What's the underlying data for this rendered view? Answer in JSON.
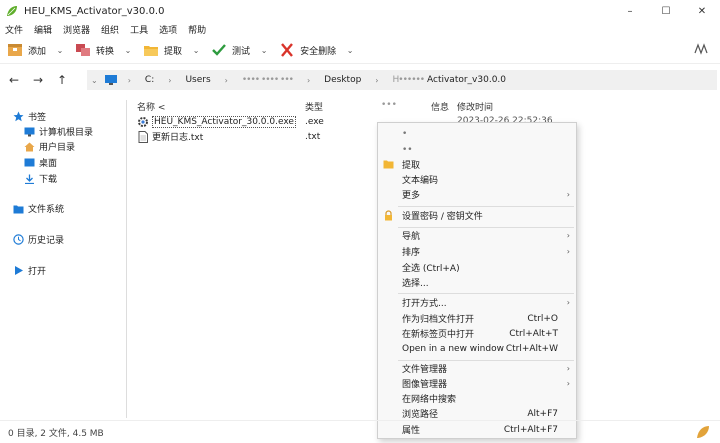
{
  "window": {
    "title": "HEU_KMS_Activator_v30.0.0",
    "minimize": "–",
    "maximize": "☐",
    "close": "✕"
  },
  "menu": [
    "文件",
    "编辑",
    "浏览器",
    "组织",
    "工具",
    "选项",
    "帮助"
  ],
  "toolbar": {
    "add": "添加",
    "convert": "转换",
    "extract": "提取",
    "test": "测试",
    "secure_delete": "安全删除"
  },
  "breadcrumb": {
    "drive": "C:",
    "users": "Users",
    "user": "•••• •••• •••",
    "desktop": "Desktop",
    "folder_prefix": "H••••••",
    "folder": "Activator_v30.0.0"
  },
  "sidebar": {
    "bookmarks": "书签",
    "computer_root": "计算机根目录",
    "user_dir": "用户目录",
    "desktop": "桌面",
    "downloads": "下载",
    "filesystem": "文件系统",
    "history": "历史记录",
    "open": "打开"
  },
  "columns": {
    "name": "名称",
    "sort": "<",
    "type": "类型",
    "size": "•••",
    "info": "信息",
    "modified": "修改时间"
  },
  "files": [
    {
      "name": "HEU_KMS_Activator_30.0.0.exe",
      "type": ".exe",
      "modified": "2023-02-26 22:52:36"
    },
    {
      "name": "更新日志.txt",
      "type": ".txt"
    }
  ],
  "context_menu": {
    "item1": "•",
    "item2": "••",
    "extract": "提取",
    "text_encoding": "文本编码",
    "more": "更多",
    "set_password": "设置密码 / 密钥文件",
    "navigate": "导航",
    "sort": "排序",
    "select_all": "全选 (Ctrl+A)",
    "select": "选择...",
    "open_with": "打开方式...",
    "open_as_archive": "作为归档文件打开",
    "open_as_archive_key": "Ctrl+O",
    "open_new_tab": "在新标签页中打开",
    "open_new_tab_key": "Ctrl+Alt+T",
    "open_new_window": "Open in a new window",
    "open_new_window_key": "Ctrl+Alt+W",
    "file_manager": "文件管理器",
    "image_manager": "图像管理器",
    "search_web": "在网络中搜索",
    "browse_path": "浏览路径",
    "browse_path_key": "Alt+F7",
    "properties": "属性",
    "properties_key": "Ctrl+Alt+F7"
  },
  "status": {
    "text": "0 目录,  2 文件,  4.5 MB"
  },
  "colors": {
    "accent": "#1e7bd6",
    "folder": "#f2b635",
    "add_icon": "#e9a74a",
    "convert_icon": "#c94a52",
    "test_icon": "#2e9b3f",
    "delete_icon": "#d9342b"
  }
}
